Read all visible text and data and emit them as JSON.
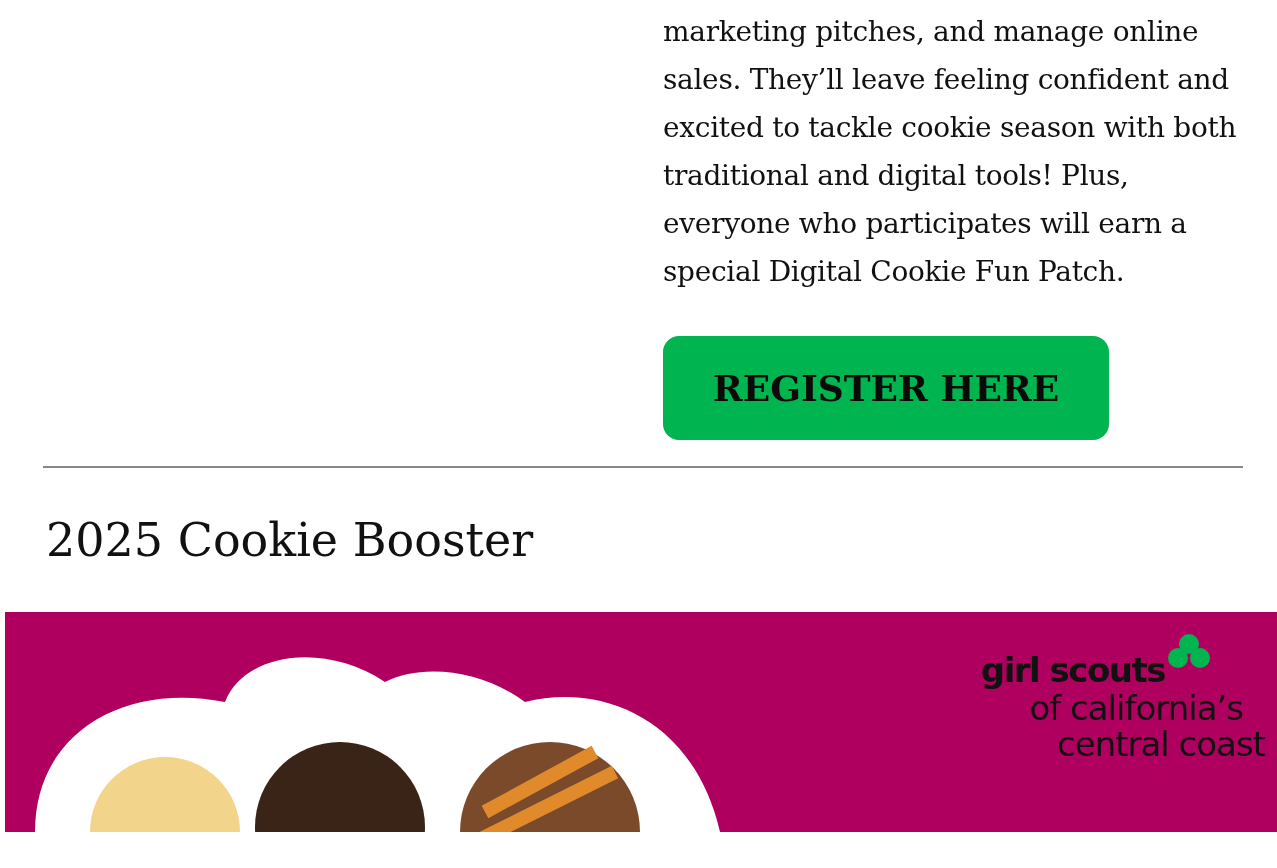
{
  "intro": {
    "text": "marketing pitches, and manage online sales. They’ll leave feeling confident and excited to tackle cookie season with both traditional and digital tools! Plus, everyone who participates will earn a special Digital Cookie Fun Patch."
  },
  "register_button": {
    "label": "REGISTER HERE"
  },
  "section": {
    "heading": "2025 Cookie Booster"
  },
  "banner": {
    "logo_lines": [
      "girl scouts",
      "of california’s",
      "central coast"
    ]
  }
}
